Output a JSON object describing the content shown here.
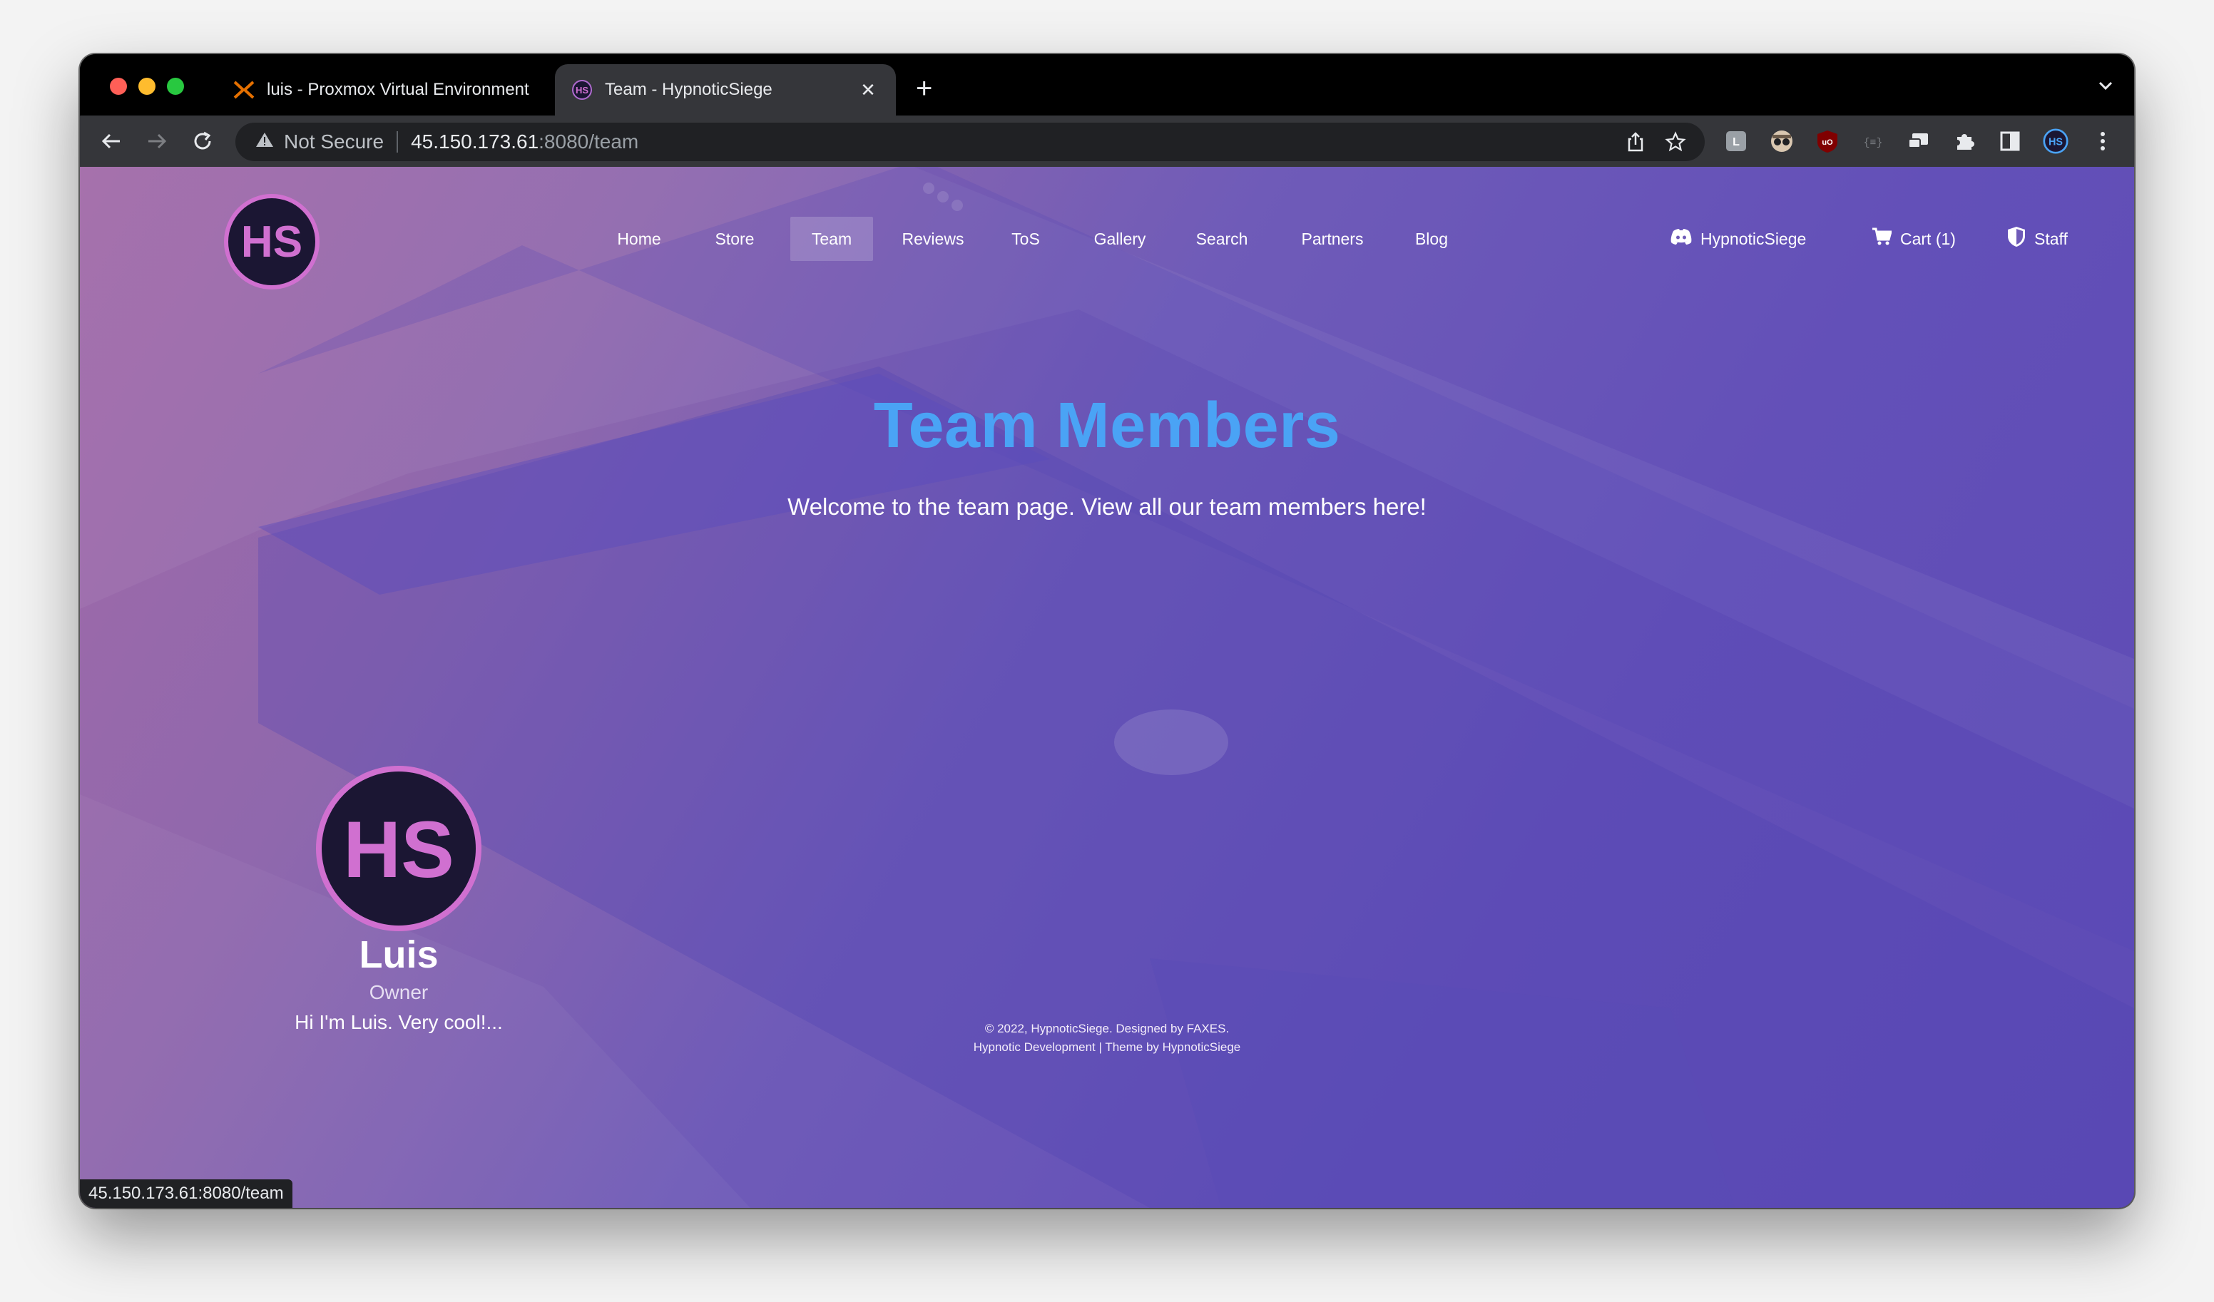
{
  "browser": {
    "tabs": [
      {
        "title": "luis - Proxmox Virtual Environment",
        "active": false,
        "favicon": "proxmox-icon"
      },
      {
        "title": "Team - HypnoticSiege",
        "active": true,
        "favicon": "hs-logo-icon"
      }
    ],
    "security_label": "Not Secure",
    "url_host": "45.150.173.61",
    "url_path": ":8080/team",
    "status_url": "45.150.173.61:8080/team",
    "profile_initials": "HS"
  },
  "site": {
    "logo_text": "HS",
    "nav": [
      "Home",
      "Store",
      "Team",
      "Reviews",
      "ToS",
      "Gallery",
      "Search",
      "Partners",
      "Blog"
    ],
    "active_nav": "Team",
    "discord_label": "HypnoticSiege",
    "cart_label": "Cart (1)",
    "staff_label": "Staff"
  },
  "hero": {
    "title": "Team Members",
    "subtitle": "Welcome to the team page. View all our team members here!"
  },
  "members": [
    {
      "name": "Luis",
      "role": "Owner",
      "bio": "Hi I'm Luis. Very cool!..."
    }
  ],
  "footer": {
    "line1": "© 2022, HypnoticSiege. Designed by FAXES.",
    "line2": "Hypnotic Development | Theme by HypnoticSiege"
  },
  "colors": {
    "accent_title": "#4aa3f5",
    "logo_ring": "#d070d0",
    "logo_bg": "#1b1633",
    "background_start": "#a26aa8",
    "background_end": "#5d4bb5"
  }
}
